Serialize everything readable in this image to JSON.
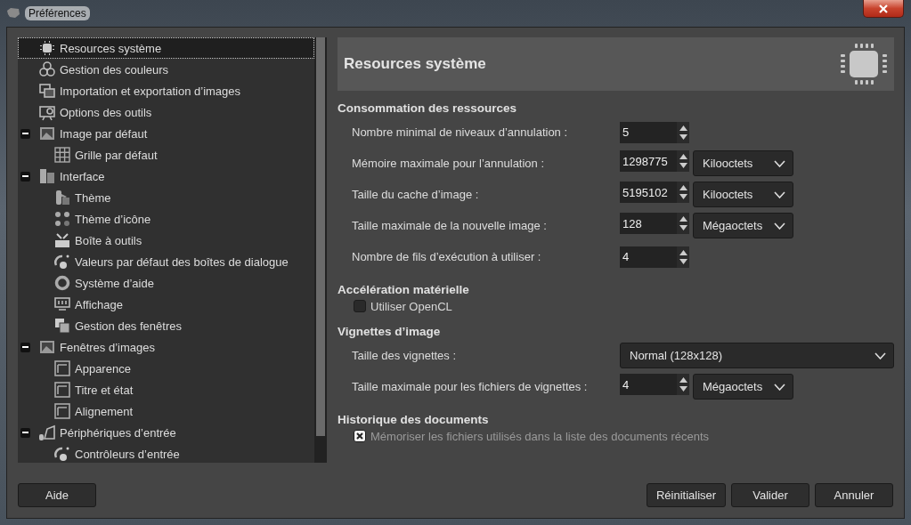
{
  "window": {
    "title": "Préférences"
  },
  "tree": [
    {
      "label": "Resources système",
      "selected": true
    },
    {
      "label": "Gestion des couleurs",
      "selected": false
    },
    {
      "label": "Importation et exportation d’images",
      "selected": false
    },
    {
      "label": "Options des outils",
      "selected": false
    },
    {
      "label": "Image par défaut",
      "selected": false,
      "expanded": true,
      "children": [
        {
          "label": "Grille par défaut",
          "selected": false
        }
      ]
    },
    {
      "label": "Interface",
      "selected": false,
      "expanded": true,
      "children": [
        {
          "label": "Thème",
          "selected": false
        },
        {
          "label": "Thème d’icône",
          "selected": false
        },
        {
          "label": "Boîte à outils",
          "selected": false
        },
        {
          "label": "Valeurs par défaut des boîtes de dialogue",
          "selected": false
        },
        {
          "label": "Système d’aide",
          "selected": false
        },
        {
          "label": "Affichage",
          "selected": false
        },
        {
          "label": "Gestion des fenêtres",
          "selected": false
        }
      ]
    },
    {
      "label": "Fenêtres d’images",
      "selected": false,
      "expanded": true,
      "children": [
        {
          "label": "Apparence",
          "selected": false
        },
        {
          "label": "Titre et état",
          "selected": false
        },
        {
          "label": "Alignement",
          "selected": false
        }
      ]
    },
    {
      "label": "Périphériques d’entrée",
      "selected": false,
      "expanded": true,
      "children": [
        {
          "label": "Contrôleurs d’entrée",
          "selected": false
        }
      ]
    }
  ],
  "page": {
    "title": "Resources système",
    "sections": [
      {
        "title": "Consommation des ressources",
        "rows": [
          {
            "kind": "spin",
            "label": "Nombre minimal de niveaux d’annulation :",
            "value": "5"
          },
          {
            "kind": "spin",
            "label": "Mémoire maximale pour l’annulation :",
            "value": "1298775",
            "unit": "Kilooctets"
          },
          {
            "kind": "spin",
            "label": "Taille du cache d’image :",
            "value": "5195102",
            "unit": "Kilooctets"
          },
          {
            "kind": "spin",
            "label": "Taille maximale de la nouvelle image :",
            "value": "128",
            "unit": "Mégaoctets"
          },
          {
            "kind": "spin",
            "label": "Nombre de fils d’exécution à utiliser :",
            "value": "4"
          }
        ]
      },
      {
        "title": "Accélération matérielle",
        "rows": [
          {
            "kind": "check",
            "label": "Utiliser OpenCL",
            "checked": false,
            "disabled": false
          }
        ]
      },
      {
        "title": "Vignettes d’image",
        "rows": [
          {
            "kind": "combo",
            "label": "Taille des vignettes :",
            "value": "Normal (128x128)"
          },
          {
            "kind": "spin",
            "label": "Taille maximale pour les fichiers de vignettes :",
            "value": "4",
            "unit": "Mégaoctets"
          }
        ]
      },
      {
        "title": "Historique des documents",
        "rows": [
          {
            "kind": "check",
            "label": "Mémoriser les fichiers utilisés dans la liste des documents récents",
            "checked": true,
            "disabled": true
          }
        ]
      }
    ]
  },
  "buttons": {
    "help": "Aide",
    "actions": [
      "Réinitialiser",
      "Valider",
      "Annuler"
    ]
  }
}
